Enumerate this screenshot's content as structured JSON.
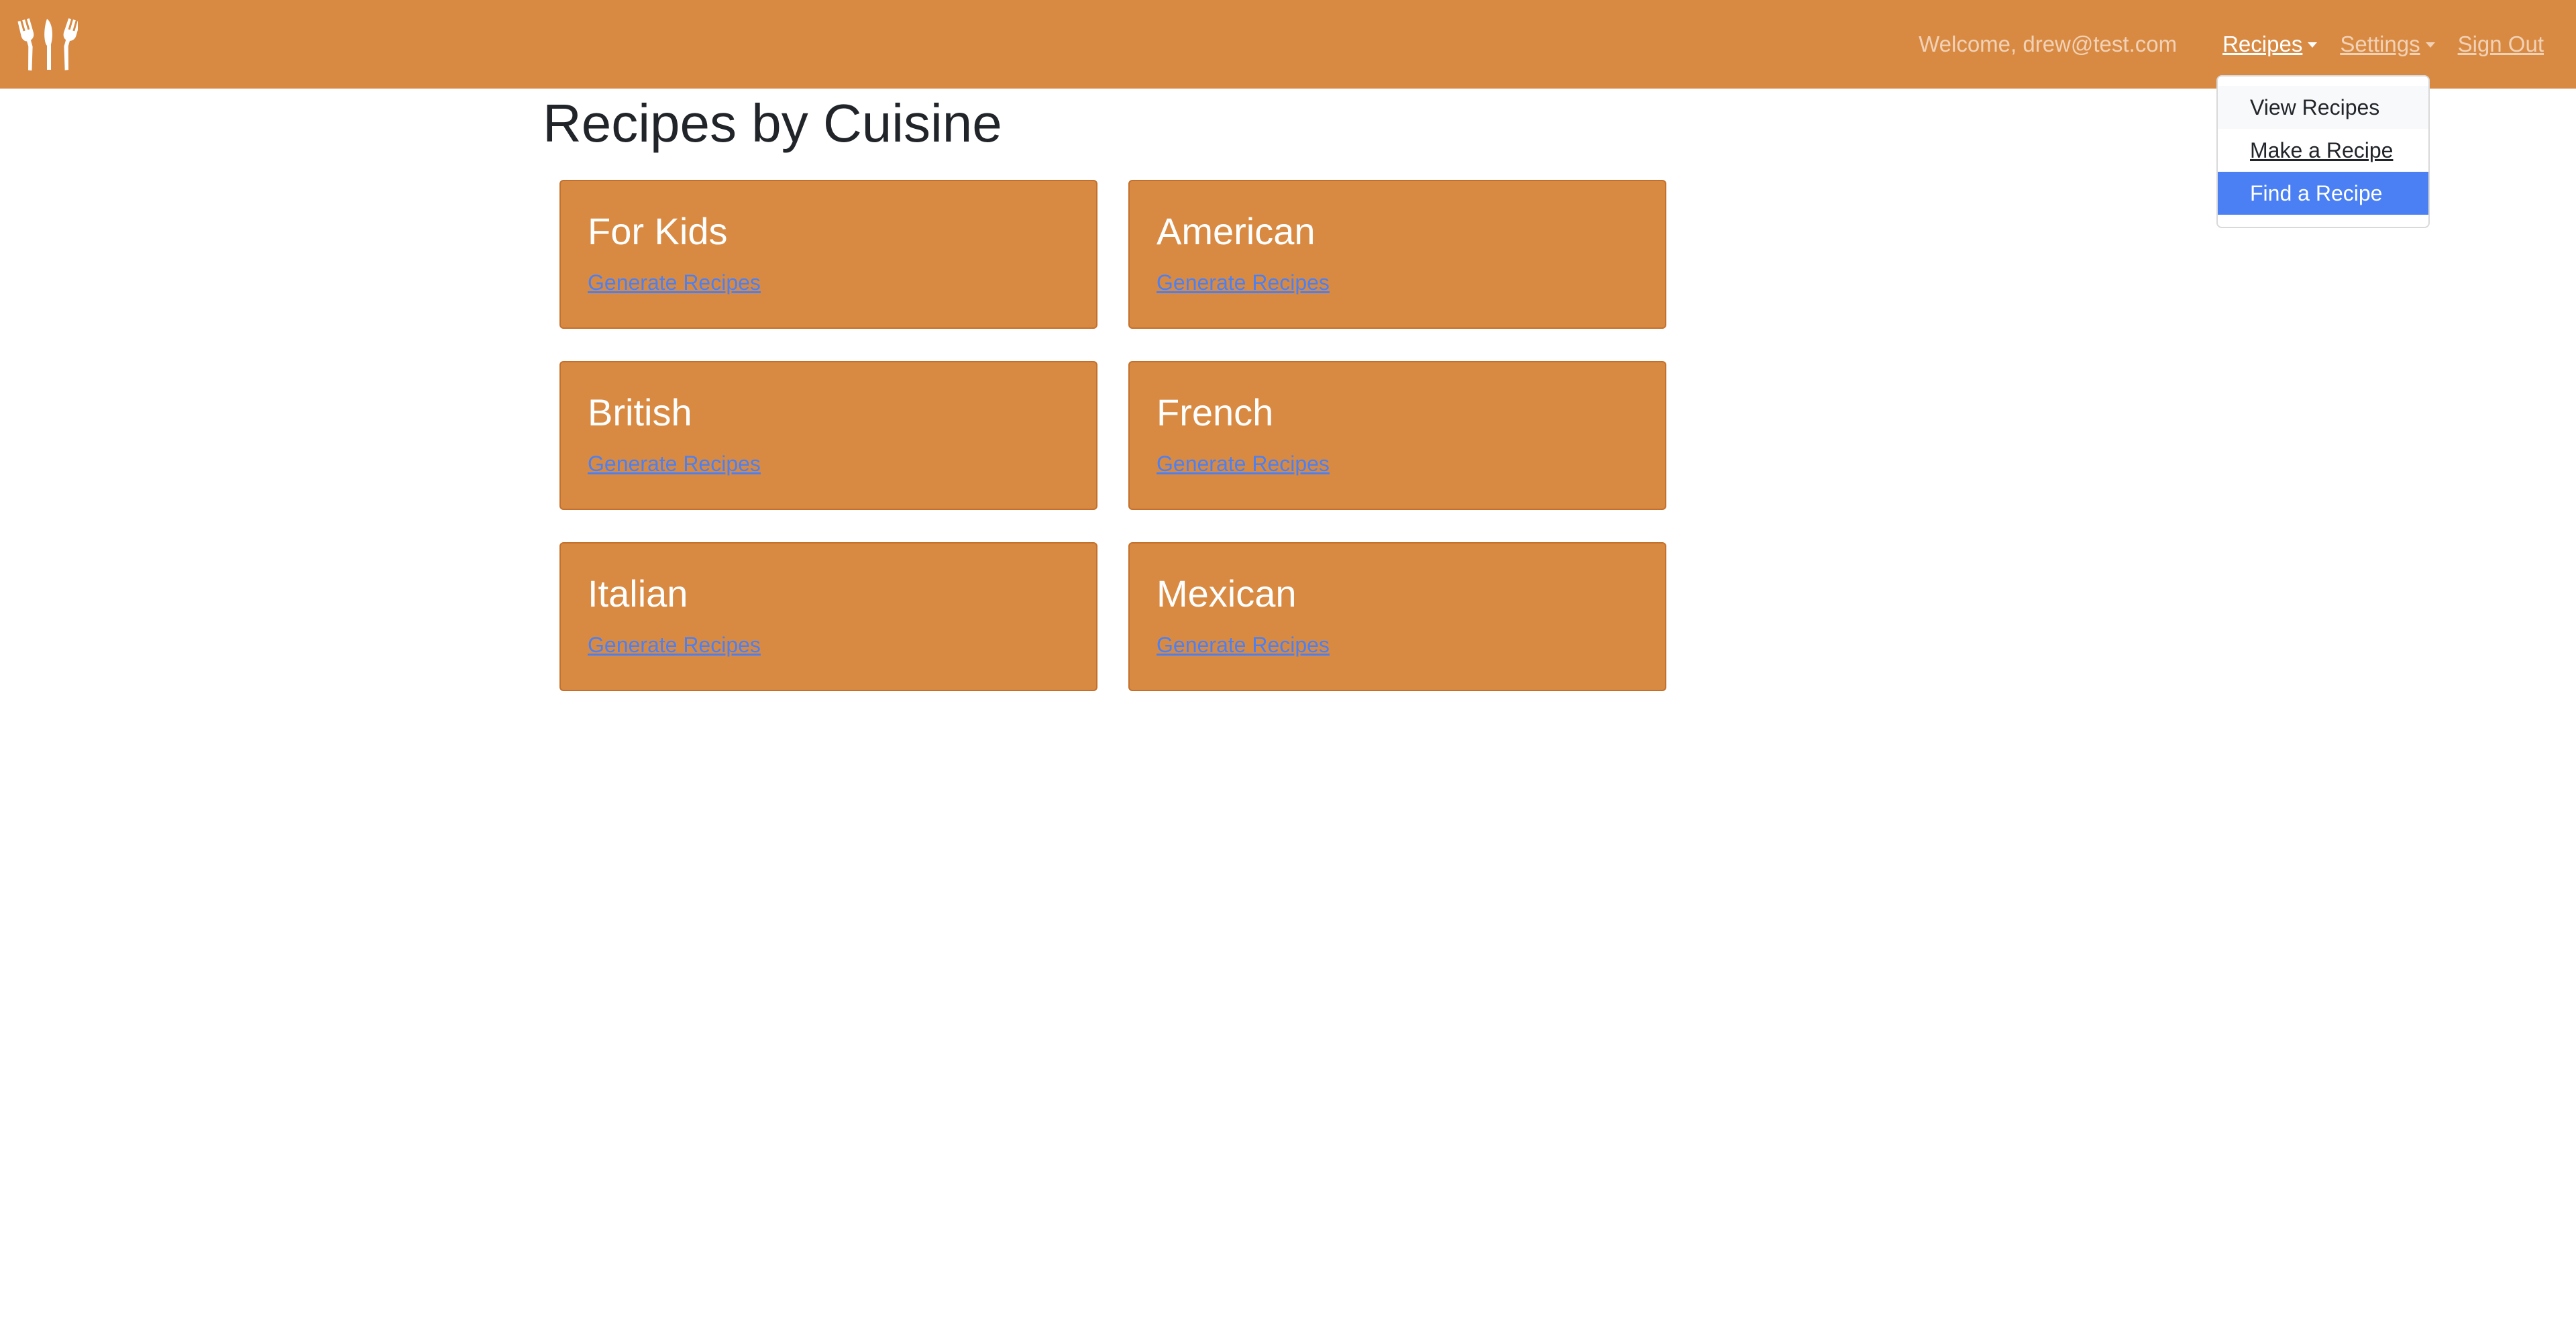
{
  "navbar": {
    "logo_icon": "fork-knife-icon",
    "welcome_text": "Welcome, drew@test.com",
    "recipes_label": "Recipes",
    "settings_label": "Settings",
    "signout_label": "Sign Out",
    "background_color": "#D98A42"
  },
  "recipes_menu": {
    "items": [
      {
        "label": "View Recipes"
      },
      {
        "label": "Make a Recipe"
      },
      {
        "label": "Find a Recipe"
      }
    ],
    "selected": "Find a Recipe",
    "selected_color": "#4A80F4"
  },
  "page": {
    "title": "Recipes by Cuisine"
  },
  "cuisines": [
    {
      "title": "For Kids",
      "link": "Generate Recipes"
    },
    {
      "title": "American",
      "link": "Generate Recipes"
    },
    {
      "title": "British",
      "link": "Generate Recipes"
    },
    {
      "title": "French",
      "link": "Generate Recipes"
    },
    {
      "title": "Italian",
      "link": "Generate Recipes"
    },
    {
      "title": "Mexican",
      "link": "Generate Recipes"
    }
  ]
}
